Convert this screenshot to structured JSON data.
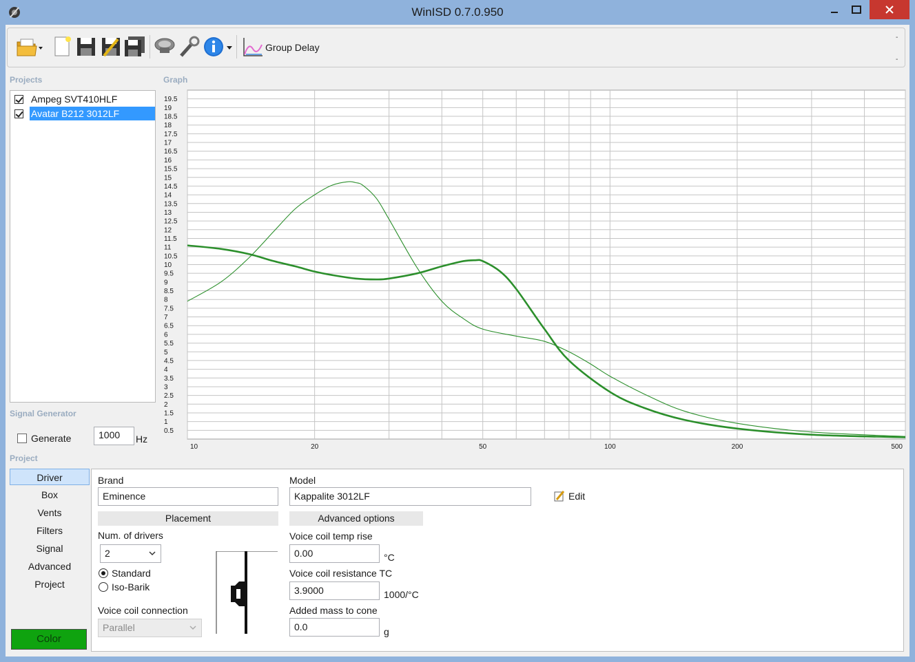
{
  "window": {
    "title": "WinISD 0.7.0.950"
  },
  "toolbar": {
    "group_delay_label": "Group Delay",
    "icons": [
      "open-folder-icon",
      "new-document-icon",
      "save-icon",
      "save-as-icon",
      "save-all-icon",
      "driver-icon",
      "tools-icon",
      "info-icon",
      "group-delay-chart-icon"
    ],
    "overflow_top": "-",
    "overflow_bottom": "-"
  },
  "projects": {
    "section_label": "Projects",
    "items": [
      {
        "label": "Ampeg SVT410HLF",
        "checked": true,
        "selected": false
      },
      {
        "label": "Avatar B212 3012LF",
        "checked": true,
        "selected": true
      }
    ]
  },
  "graph": {
    "section_label": "Graph"
  },
  "chart_data": {
    "type": "line",
    "xscale": "log",
    "xlim": [
      10,
      500
    ],
    "ylim": [
      0,
      20
    ],
    "grid": true,
    "x_ticks": [
      "10",
      "20",
      "50",
      "100",
      "200",
      "500"
    ],
    "y_ticks": [
      "0.5",
      "1",
      "1.5",
      "2",
      "2.5",
      "3",
      "3.5",
      "4",
      "4.5",
      "5",
      "5.5",
      "6",
      "6.5",
      "7",
      "7.5",
      "8",
      "8.5",
      "9",
      "9.5",
      "10",
      "10.5",
      "11",
      "11.5",
      "12",
      "12.5",
      "13",
      "13.5",
      "14",
      "14.5",
      "15",
      "15.5",
      "16",
      "16.5",
      "17",
      "17.5",
      "18",
      "18.5",
      "19",
      "19.5"
    ],
    "series": [
      {
        "color": "#2c8f2c",
        "width": "thin",
        "x": [
          10,
          12,
          14,
          16,
          18,
          20,
          22,
          24,
          25,
          26,
          28,
          30,
          35,
          40,
          45,
          50,
          60,
          70,
          80,
          90,
          100,
          120,
          150,
          200,
          300,
          500
        ],
        "y": [
          7.9,
          9.0,
          10.4,
          11.9,
          13.2,
          14.0,
          14.55,
          14.75,
          14.7,
          14.55,
          13.8,
          12.6,
          9.8,
          7.9,
          6.9,
          6.3,
          5.9,
          5.6,
          5.0,
          4.3,
          3.6,
          2.6,
          1.6,
          0.9,
          0.4,
          0.15
        ]
      },
      {
        "color": "#2c8f2c",
        "width": "thick",
        "x": [
          10,
          12,
          14,
          16,
          18,
          20,
          22,
          25,
          28,
          30,
          35,
          40,
          45,
          48,
          50,
          55,
          60,
          70,
          80,
          100,
          120,
          150,
          200,
          300,
          500
        ],
        "y": [
          11.1,
          10.9,
          10.6,
          10.2,
          9.9,
          9.6,
          9.4,
          9.2,
          9.15,
          9.2,
          9.5,
          9.9,
          10.2,
          10.25,
          10.2,
          9.6,
          8.6,
          6.3,
          4.5,
          2.7,
          1.8,
          1.1,
          0.6,
          0.25,
          0.1
        ]
      }
    ]
  },
  "signal_generator": {
    "section_label": "Signal Generator",
    "generate_label": "Generate",
    "generate_checked": false,
    "frequency": "1000",
    "unit": "Hz"
  },
  "project": {
    "section_label": "Project",
    "nav": [
      "Driver",
      "Box",
      "Vents",
      "Filters",
      "Signal",
      "Advanced",
      "Project"
    ],
    "active_nav": 0,
    "color_button": "Color",
    "color_value": "#0fa30f"
  },
  "driver": {
    "brand_label": "Brand",
    "brand_value": "Eminence",
    "model_label": "Model",
    "model_value": "Kappalite 3012LF",
    "edit_label": "Edit",
    "placement_header": "Placement",
    "num_drivers_label": "Num. of drivers",
    "num_drivers_value": "2",
    "standard_label": "Standard",
    "isobarik_label": "Iso-Barik",
    "standard_selected": true,
    "voice_coil_connection_label": "Voice coil connection",
    "voice_coil_connection_value": "Parallel",
    "advanced_header": "Advanced options",
    "vc_temp_rise_label": "Voice coil temp rise",
    "vc_temp_rise_value": "0.00",
    "vc_temp_rise_unit": "°C",
    "vc_resistance_tc_label": "Voice coil resistance TC",
    "vc_resistance_tc_value": "3.9000",
    "vc_resistance_tc_unit": "1000/°C",
    "added_mass_label": "Added mass to cone",
    "added_mass_value": "0.0",
    "added_mass_unit": "g"
  }
}
